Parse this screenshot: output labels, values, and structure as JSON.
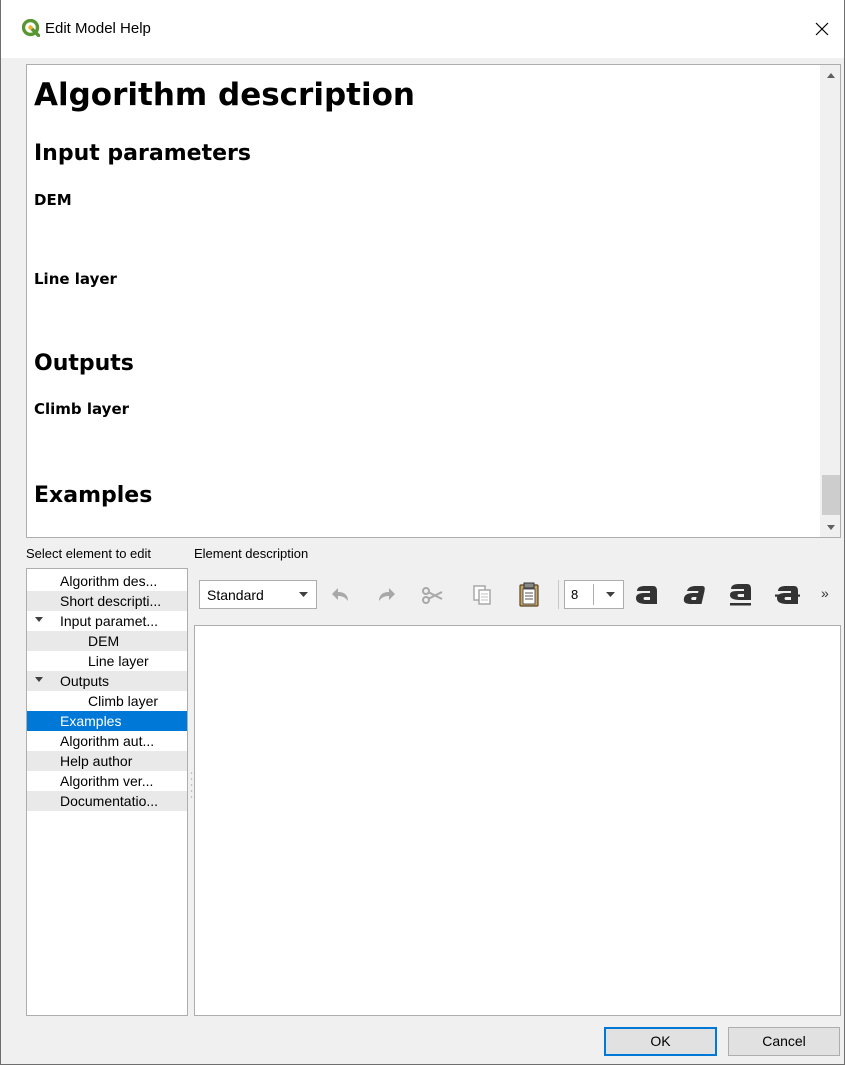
{
  "window": {
    "title": "Edit Model Help",
    "icon": "qgis-logo-icon",
    "accent_color": "#589632"
  },
  "preview": {
    "heading": "Algorithm description",
    "input_params_heading": "Input parameters",
    "param1": "DEM",
    "param2": "Line layer",
    "outputs_heading": "Outputs",
    "output1": "Climb layer",
    "examples_heading": "Examples"
  },
  "labels": {
    "select_element": "Select element to edit",
    "element_description": "Element description"
  },
  "tree": {
    "items": [
      {
        "label": "Algorithm des...",
        "level": 1
      },
      {
        "label": "Short descripti...",
        "level": 1
      },
      {
        "label": "Input paramet...",
        "level": 0,
        "expanded": true
      },
      {
        "label": "DEM",
        "level": 2
      },
      {
        "label": "Line layer",
        "level": 2
      },
      {
        "label": "Outputs",
        "level": 0,
        "expanded": true
      },
      {
        "label": "Climb layer",
        "level": 2
      },
      {
        "label": "Examples",
        "level": 1,
        "selected": true
      },
      {
        "label": "Algorithm aut...",
        "level": 1
      },
      {
        "label": "Help author",
        "level": 1
      },
      {
        "label": "Algorithm ver...",
        "level": 1
      },
      {
        "label": "Documentatio...",
        "level": 1
      }
    ],
    "selected_color": "#0078d7"
  },
  "toolbar": {
    "paragraph_style": "Standard",
    "font_size": "8",
    "icons": [
      "undo-icon",
      "redo-icon",
      "cut-icon",
      "copy-icon",
      "paste-icon",
      "bold-icon",
      "italic-icon",
      "underline-icon",
      "strikethrough-icon",
      "more-icon"
    ],
    "overflow": "»"
  },
  "buttons": {
    "ok": "OK",
    "cancel": "Cancel"
  }
}
